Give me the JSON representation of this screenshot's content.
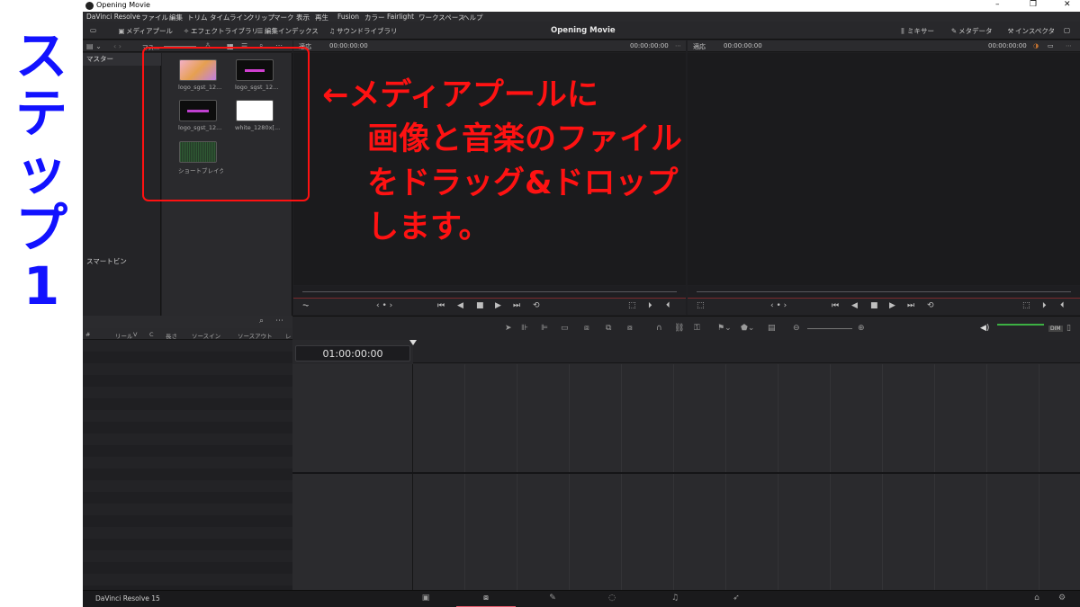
{
  "step": {
    "label": "ステップ1"
  },
  "window": {
    "title": "Opening Movie",
    "minimize": "–",
    "restore": "❐",
    "close": "✕"
  },
  "menu": [
    "DaVinci Resolve",
    "ファイル",
    "編集",
    "トリム",
    "タイムライン",
    "クリップ",
    "マーク",
    "表示",
    "再生",
    "Fusion",
    "カラー",
    "Fairlight",
    "ワークスペース",
    "ヘルプ"
  ],
  "toolbar": {
    "media_pool": "メディアプール",
    "effects_library": "エフェクトライブラリ",
    "edit_index": "編集インデックス",
    "sound_library": "サウンドライブラリ",
    "project_title": "Opening Movie",
    "mixer": "ミキサー",
    "metadata": "メタデータ",
    "inspector": "インスペクタ"
  },
  "media_pool": {
    "bin_master": "マスター",
    "bin_path": "マス...",
    "smart_bins": "スマートビン",
    "clips": [
      {
        "name": "logo_sgst_12...",
        "thumb": "#e8a0b8"
      },
      {
        "name": "logo_sgst_12...",
        "thumb": "#0d0d0d"
      },
      {
        "name": "logo_sgst_12...",
        "thumb": "#0d0d0d"
      },
      {
        "name": "white_1280x[...",
        "thumb": "#ffffff"
      },
      {
        "name": "ショートブレイク ...",
        "thumb": "#3a4a3a"
      }
    ]
  },
  "source_viewer": {
    "fit": "適応",
    "tc_left": "00:00:00:00",
    "tc_right": "00:00:00:00"
  },
  "timeline_viewer": {
    "fit": "適応",
    "tc_left": "00:00:00:00",
    "tc_right": "00:00:00:00"
  },
  "edit_index": {
    "columns": [
      "#",
      "リール",
      "V",
      "C",
      "長さ",
      "ソースイン",
      "ソースアウト",
      "レ"
    ]
  },
  "timeline": {
    "timecode": "01:00:00:00"
  },
  "pagebar": {
    "brand": "DaVinci Resolve 15"
  },
  "annotation": {
    "lines": [
      "←メディアプールに",
      "画像と音楽のファイル",
      "をドラッグ&ドロップ",
      "します。"
    ],
    "color": "#ff1212"
  },
  "colors": {
    "step_label": "#1212ff",
    "highlight": "#ff1111"
  }
}
